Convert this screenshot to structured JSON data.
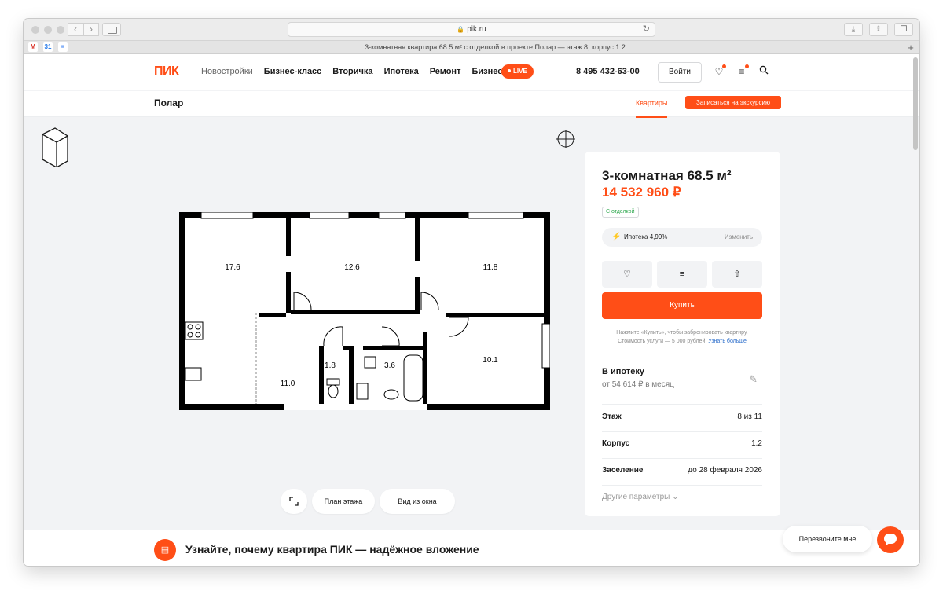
{
  "browser": {
    "url": "pik.ru",
    "tab_title": "3-комнатная квартира 68.5 м² с отделкой в проекте Полар — этаж 8, корпус 1.2",
    "new_tab": "+",
    "favicons": [
      {
        "name": "gmail-icon",
        "glyph": "M",
        "color": "#d93025"
      },
      {
        "name": "calendar-icon",
        "glyph": "31",
        "color": "#1a73e8"
      },
      {
        "name": "docs-icon",
        "glyph": "≡",
        "color": "#4285f4"
      }
    ]
  },
  "header": {
    "logo": "ПИК",
    "menu": [
      "Новостройки",
      "Бизнес-класс",
      "Вторичка",
      "Ипотека",
      "Ремонт",
      "Бизнесу"
    ],
    "live": "LIVE",
    "phone": "8 495 432-63-00",
    "login": "Войти"
  },
  "subnav": {
    "project": "Полар",
    "tab": "Квартиры",
    "tour": "Записаться на экскурсию"
  },
  "plan": {
    "rooms": [
      "17.6",
      "12.6",
      "11.8",
      "10.1",
      "11.0",
      "1.8",
      "3.6"
    ]
  },
  "plan_controls": {
    "floor_plan": "План этажа",
    "window_view": "Вид из окна"
  },
  "card": {
    "title": "3-комнатная 68.5 м²",
    "price": "14 532 960 ₽",
    "badge": "С отделкой",
    "mortgage_rate": "Ипотека 4,99%",
    "change": "Изменить",
    "buy": "Купить",
    "note_line1": "Нажмите «Купить», чтобы забронировать квартиру.",
    "note_line2": "Стоимость услуги — 5 000 рублей.",
    "note_link": "Узнать больше",
    "mortgage_title": "В ипотеку",
    "mortgage_monthly": "от 54 614 ₽ в месяц",
    "params": [
      {
        "key": "Этаж",
        "value": "8 из 11"
      },
      {
        "key": "Корпус",
        "value": "1.2"
      },
      {
        "key": "Заселение",
        "value": "до 28 февраля 2026"
      }
    ],
    "more": "Другие параметры"
  },
  "bottom": {
    "title": "Узнайте, почему квартира ПИК — надёжное вложение",
    "callback": "Перезвоните мне"
  },
  "colors": {
    "accent": "#ff4e17",
    "badge": "#2fa84f",
    "link": "#2c6ecb"
  }
}
